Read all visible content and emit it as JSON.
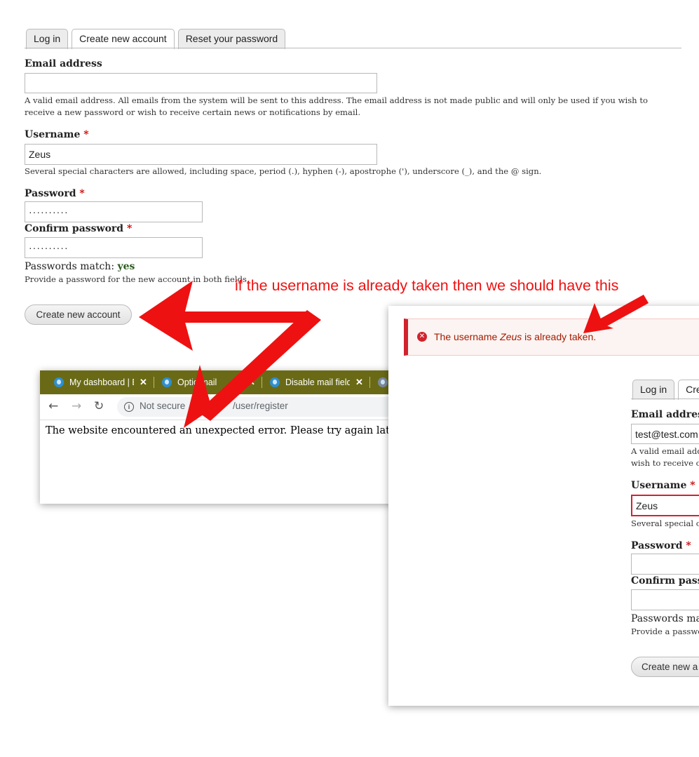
{
  "main_form": {
    "tabs": [
      {
        "label": "Log in"
      },
      {
        "label": "Create new account",
        "active": true
      },
      {
        "label": "Reset your password"
      }
    ],
    "email_label": "Email address",
    "email_value": "",
    "email_desc": "A valid email address. All emails from the system will be sent to this address. The email address is not made public and will only be used if you wish to receive a new password or wish to receive certain news or notifications by email.",
    "username_label": "Username",
    "required_mark": "*",
    "username_value": "Zeus",
    "username_desc": "Several special characters are allowed, including space, period (.), hyphen (-), apostrophe ('), underscore (_), and the @ sign.",
    "password_label": "Password",
    "password_value": "··········",
    "confirm_label": "Confirm password",
    "confirm_value": "··········",
    "match_label": "Passwords match:",
    "match_value": "yes",
    "password_desc": "Provide a password for the new account in both fields.",
    "submit_label": "Create new account"
  },
  "annotation": {
    "text": "if the username is already taken then we should have this",
    "color": "#ee1111"
  },
  "browser": {
    "tabs": [
      {
        "title": "My dashboard | E",
        "close": "✕"
      },
      {
        "title": "Optio mail",
        "close": "✕"
      },
      {
        "title": "Disable mail field",
        "close": "✕"
      }
    ],
    "not_secure": "Not secure",
    "url": "/user/register",
    "error_text": "The website encountered an unexpected error. Please try again later.",
    "tabbar_color": "#6a6a16"
  },
  "error_panel": {
    "message_prefix": "The username ",
    "message_name": "Zeus",
    "message_suffix": " is already taken.",
    "tabs": [
      {
        "label": "Log in"
      },
      {
        "label": "Cre",
        "active": true
      }
    ],
    "email_label": "Email address",
    "email_value": "test@test.com",
    "email_desc_line1": "A valid email addre",
    "email_desc_line2": "wish to receive cer",
    "username_label": "Username",
    "username_value": "Zeus",
    "username_desc": "Several special cha",
    "password_label": "Password",
    "confirm_label": "Confirm passw",
    "match_label": "Passwords matc",
    "password_desc": "Provide a passwore",
    "submit_label": "Create new a",
    "error_color": "#d1232e"
  }
}
